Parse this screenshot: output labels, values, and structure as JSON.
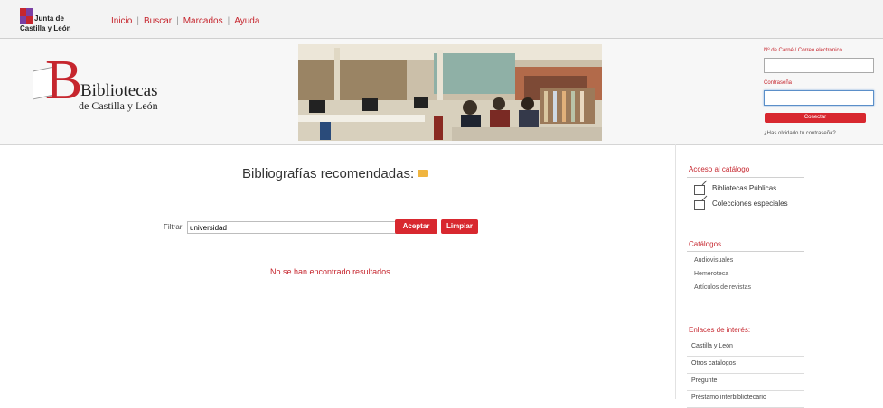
{
  "topbar": {
    "brand_line1": "Junta de",
    "brand_line2": "Castilla y León",
    "nav": [
      {
        "label": "Inicio"
      },
      {
        "label": "Buscar"
      },
      {
        "label": "Marcados"
      },
      {
        "label": "Ayuda"
      }
    ],
    "separator": "|"
  },
  "header": {
    "logo_letter": "B",
    "logo_line1": "Bibliotecas",
    "logo_line2": "de Castilla y León"
  },
  "login": {
    "user_label": "Nº de Carné / Correo electrónico",
    "user_value": "",
    "password_label": "Contraseña",
    "password_value": "",
    "submit_label": "Conectar",
    "forgot_label": "¿Has olvidado tu contraseña?"
  },
  "main": {
    "title": "Bibliografías recomendadas:",
    "filter_label": "Filtrar",
    "filter_value": "universidad",
    "accept_label": "Aceptar",
    "clear_label": "Limpiar",
    "no_results": "No se han encontrado resultados"
  },
  "sidebar": {
    "access_title": "Acceso al catálogo",
    "access_links": [
      {
        "label": "Bibliotecas Públicas"
      },
      {
        "label": "Colecciones especiales"
      }
    ],
    "catalogs_title": "Catálogos",
    "catalogs": [
      {
        "label": "Audiovisuales"
      },
      {
        "label": "Hemeroteca"
      },
      {
        "label": "Artículos de revistas"
      }
    ],
    "links_title": "Enlaces de interés:",
    "links": [
      {
        "label": "Castilla y León"
      },
      {
        "label": "Otros catálogos"
      },
      {
        "label": "Pregunte"
      },
      {
        "label": "Préstamo interbibliotecario"
      }
    ]
  },
  "colors": {
    "accent": "#c6262e",
    "button": "#d8282f",
    "folder_icon": "#f0b540"
  }
}
